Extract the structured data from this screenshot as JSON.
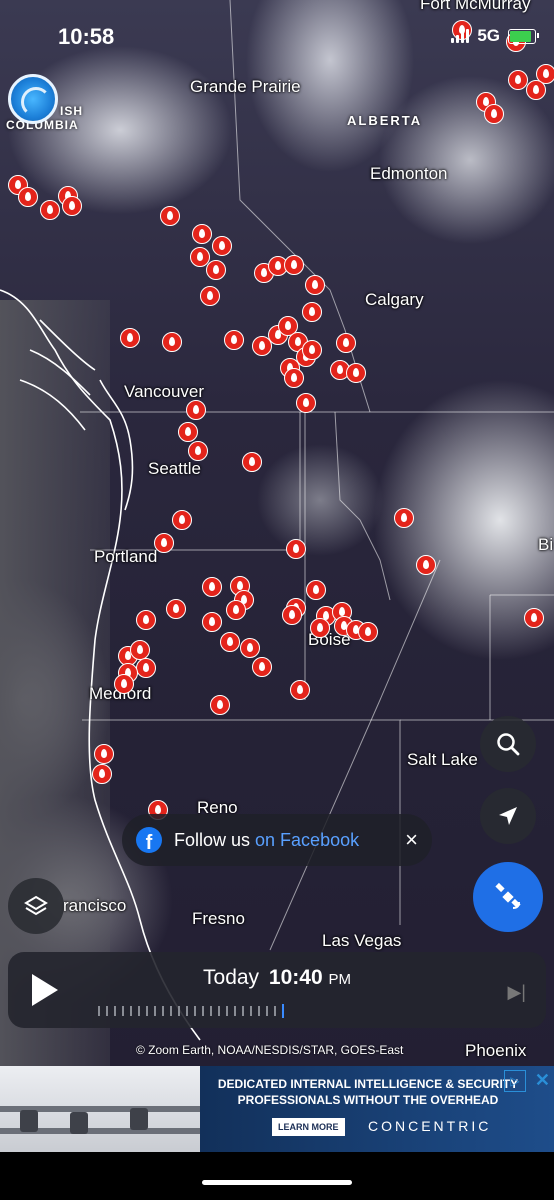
{
  "status_bar": {
    "time": "10:58",
    "network": "5G"
  },
  "region_labels": [
    "ALBERTA",
    "BRITISH COLUMBIA"
  ],
  "cities": {
    "fort_mcmurray": "Fort McMurray",
    "grande_prairie": "Grande Prairie",
    "edmonton": "Edmonton",
    "calgary": "Calgary",
    "vancouver": "Vancouver",
    "seattle": "Seattle",
    "portland": "Portland",
    "boise": "Boise",
    "medford": "Medford",
    "salt_lake": "Salt Lake",
    "reno": "Reno",
    "san_francisco": "rancisco",
    "fresno": "Fresno",
    "las_vegas": "Las Vegas",
    "phoenix": "Phoenix",
    "billings_partial": "Bi"
  },
  "facebook_prompt": {
    "text": "Follow us",
    "link": "on Facebook",
    "close": "×"
  },
  "timeline": {
    "day": "Today",
    "hour": "10",
    "minute": "40",
    "ampm": "PM"
  },
  "credit": "© Zoom Earth, NOAA/NESDIS/STAR, GOES-East",
  "ad": {
    "headline": "DEDICATED INTERNAL INTELLIGENCE & SECURITY PROFESSIONALS WITHOUT THE OVERHEAD",
    "button": "LEARN MORE",
    "brand": "CONCENTRIC"
  },
  "icons": {
    "layers": "layers-icon",
    "search": "search-icon",
    "locate": "location-arrow-icon",
    "satellite": "satellite-icon",
    "fire": "fire-icon"
  },
  "colors": {
    "fire": "#e3241b",
    "accent": "#1f6fe6",
    "link": "#59a0ff"
  }
}
